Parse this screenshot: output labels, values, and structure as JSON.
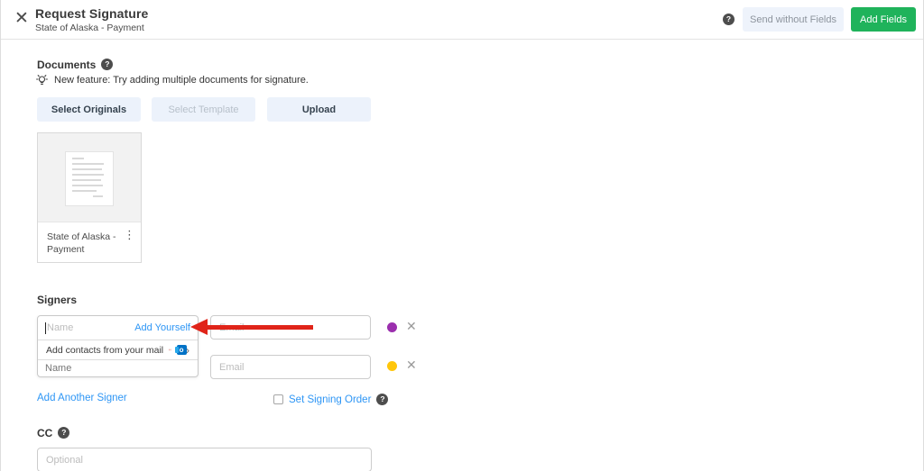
{
  "header": {
    "close_icon": "✕",
    "title": "Request Signature",
    "subtitle": "State of Alaska - Payment",
    "help_icon": "?",
    "send_without_fields_label": "Send without Fields",
    "add_fields_label": "Add Fields"
  },
  "documents": {
    "heading": "Documents",
    "help_icon": "?",
    "tip": "New feature: Try adding multiple documents for signature.",
    "buttons": [
      {
        "label": "Select Originals",
        "enabled": true
      },
      {
        "label": "Select Template",
        "enabled": false
      },
      {
        "label": "Upload",
        "enabled": true
      }
    ],
    "card": {
      "title_line1": "State of Alaska -",
      "title_line2": "Payment",
      "menu_icon": "⋮"
    }
  },
  "signers": {
    "heading": "Signers",
    "name_placeholder": "Name",
    "email_placeholder": "Email",
    "add_yourself_label": "Add Yourself",
    "add_contacts_label": "Add contacts from your mail",
    "gmail_icon": "gmail",
    "outlook_icon": "o",
    "chevron_icon": "›",
    "remove_icon": "✕",
    "rows": [
      {
        "color": "#9b2fae"
      },
      {
        "color": "#ffc60a"
      }
    ],
    "add_another_label": "Add Another Signer",
    "set_signing_order_label": "Set Signing Order",
    "help_icon": "?"
  },
  "cc": {
    "heading": "CC",
    "help_icon": "?",
    "placeholder": "Optional"
  },
  "colors": {
    "accent_green": "#1fb35b",
    "link_blue": "#2e96f5",
    "arrow_red": "#e02419"
  }
}
